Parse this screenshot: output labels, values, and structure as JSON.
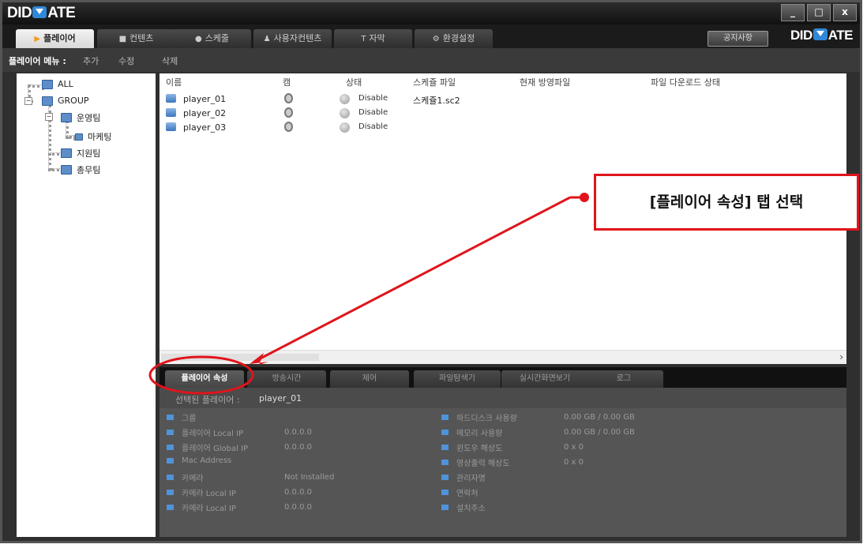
{
  "app": {
    "logo": "DIDMATE",
    "logo_left": "DID",
    "logo_right": "ATE"
  },
  "window_buttons": {
    "minimize": "_",
    "maximize": "□",
    "close": "x"
  },
  "tabs": [
    {
      "label": "플레이어",
      "icon": "play-icon",
      "active": true
    },
    {
      "label": "컨텐츠",
      "icon": "contents-icon"
    },
    {
      "label": "스케줄",
      "icon": "clock-icon"
    },
    {
      "label": "사용자컨텐츠",
      "icon": "user-icon"
    },
    {
      "label": "자막",
      "icon": "text-icon"
    },
    {
      "label": "환경설정",
      "icon": "settings-icon"
    }
  ],
  "notice_button": "공지사항",
  "menu": {
    "label": "플레이어 메뉴 :",
    "items": [
      "추가",
      "수정",
      "삭제"
    ]
  },
  "tree": [
    {
      "label": "ALL",
      "level": 0
    },
    {
      "label": "GROUP",
      "level": 0
    },
    {
      "label": "운영팀",
      "level": 1
    },
    {
      "label": "마케팅",
      "level": 2
    },
    {
      "label": "지원팀",
      "level": 1
    },
    {
      "label": "총무팀",
      "level": 1
    }
  ],
  "list": {
    "columns": [
      "이름",
      "캠",
      "상태",
      "스케쥴 파일",
      "현재 방영파일",
      "파일 다운로드 상태"
    ],
    "rows": [
      {
        "name": "player_01",
        "status": "Disable",
        "schedule": "스케쥴1.sc2"
      },
      {
        "name": "player_02",
        "status": "Disable",
        "schedule": ""
      },
      {
        "name": "player_03",
        "status": "Disable",
        "schedule": ""
      }
    ]
  },
  "bottom_tabs": [
    "플레이어 속성",
    "방송시간",
    "제어",
    "파일탐색기",
    "실시간화면보기",
    "로그"
  ],
  "selected": {
    "label": "선택된 플레이어 :",
    "value": "player_01"
  },
  "props_left": [
    {
      "label": "그룹",
      "value": ""
    },
    {
      "label": "플레이어 Local IP",
      "value": "0.0.0.0"
    },
    {
      "label": "플레이어 Global IP",
      "value": "0.0.0.0"
    },
    {
      "label": "Mac Address",
      "value": ""
    },
    {
      "label": "카메라",
      "value": "Not Installed"
    },
    {
      "label": "카메라 Local IP",
      "value": "0.0.0.0"
    },
    {
      "label": "카메라 Local IP",
      "value": "0.0.0.0"
    }
  ],
  "props_right": [
    {
      "label": "하드디스크 사용량",
      "value": "0.00 GB / 0.00 GB"
    },
    {
      "label": "메모리 사용량",
      "value": "0.00 GB / 0.00 GB"
    },
    {
      "label": "윈도우 해상도",
      "value": "0 x 0"
    },
    {
      "label": "영상출력 해상도",
      "value": "0 x 0"
    },
    {
      "label": "관리자명",
      "value": ""
    },
    {
      "label": "연락처",
      "value": ""
    },
    {
      "label": "설치주소",
      "value": ""
    }
  ],
  "annotation": {
    "text": "[플레이어 속성] 탭 선택",
    "color": "#e0141b"
  }
}
